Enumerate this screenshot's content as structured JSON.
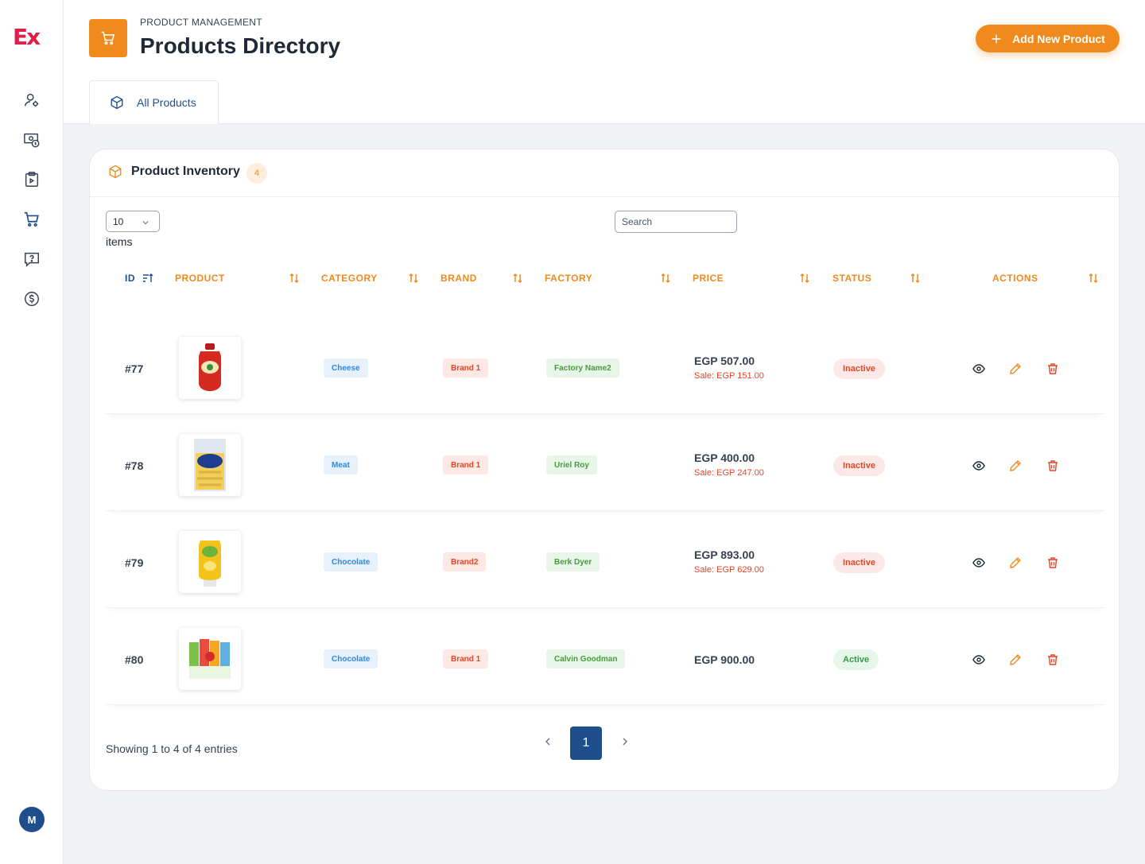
{
  "app": {
    "logo": "Ex",
    "user_initial": "M"
  },
  "sidebar": {
    "items": [
      {
        "name": "user-settings-icon"
      },
      {
        "name": "money-icon"
      },
      {
        "name": "clipboard-icon"
      },
      {
        "name": "cart-icon"
      },
      {
        "name": "help-icon"
      },
      {
        "name": "dollar-icon"
      }
    ]
  },
  "header": {
    "breadcrumb": "PRODUCT MANAGEMENT",
    "title": "Products Directory",
    "add_button": "Add New Product",
    "tab_label": "All Products"
  },
  "card": {
    "title": "Product Inventory",
    "count": "4",
    "per_page": "10",
    "items_label": "items",
    "search_placeholder": "Search"
  },
  "table": {
    "headers": {
      "id": "ID",
      "product": "PRODUCT",
      "category": "CATEGORY",
      "brand": "BRAND",
      "factory": "FACTORY",
      "price": "PRICE",
      "status": "STATUS",
      "actions": "ACTIONS"
    },
    "rows": [
      {
        "id": "#77",
        "category": "Cheese",
        "brand": "Brand 1",
        "factory": "Factory Name2",
        "price": "EGP 507.00",
        "sale": "Sale: EGP 151.00",
        "status": "Inactive"
      },
      {
        "id": "#78",
        "category": "Meat",
        "brand": "Brand 1",
        "factory": "Uriel Roy",
        "price": "EGP 400.00",
        "sale": "Sale: EGP 247.00",
        "status": "Inactive"
      },
      {
        "id": "#79",
        "category": "Chocolate",
        "brand": "Brand2",
        "factory": "Berk Dyer",
        "price": "EGP 893.00",
        "sale": "Sale: EGP 629.00",
        "status": "Inactive"
      },
      {
        "id": "#80",
        "category": "Chocolate",
        "brand": "Brand 1",
        "factory": "Calvin Goodman",
        "price": "EGP 900.00",
        "sale": "",
        "status": "Active"
      }
    ]
  },
  "footer": {
    "showing": "Showing 1 to 4 of 4 entries",
    "current_page": "1"
  },
  "colors": {
    "accent": "#f08a1c",
    "primary": "#1f4e8c",
    "danger": "#e0462a",
    "success": "#2e9a44"
  }
}
